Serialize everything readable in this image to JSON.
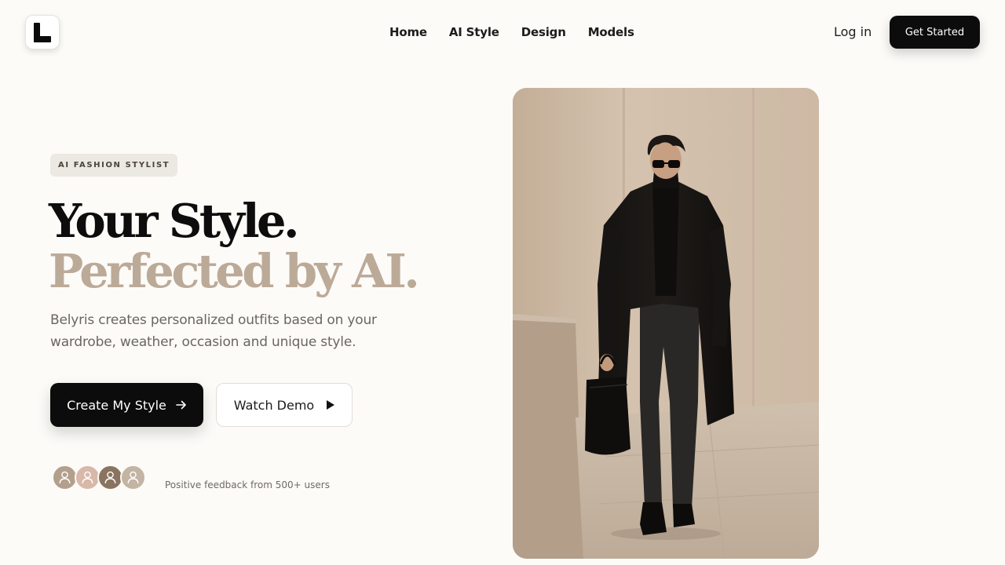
{
  "header": {
    "logo_letter": "L",
    "nav": [
      "Home",
      "AI Style",
      "Design",
      "Models"
    ],
    "login_label": "Log in",
    "cta_label": "Get Started"
  },
  "hero": {
    "badge": "AI FASHION STYLIST",
    "title_line1": "Your Style.",
    "title_line2": "Perfected by AI.",
    "subtitle": "Belyris creates personalized outfits based on your wardrobe, weather, occasion and unique style.",
    "primary_button": "Create My Style",
    "secondary_button": "Watch Demo",
    "feedback_text": "Positive feedback from 500+ users"
  },
  "avatars": [
    {
      "color": "#b3a08c",
      "icon": "user-icon"
    },
    {
      "color": "#d8b8a8",
      "icon": "user-icon"
    },
    {
      "color": "#8a7460",
      "icon": "user-icon"
    },
    {
      "color": "#c3b4a3",
      "icon": "user-icon"
    }
  ],
  "image": {
    "subject": "model-photo",
    "alt_icon": "man-in-black-coat-photo"
  },
  "colors": {
    "background": "#fcfbf8",
    "accent_text": "#bcaa98",
    "button_dark": "#0c0c0c",
    "badge_bg": "#ece8e2"
  }
}
